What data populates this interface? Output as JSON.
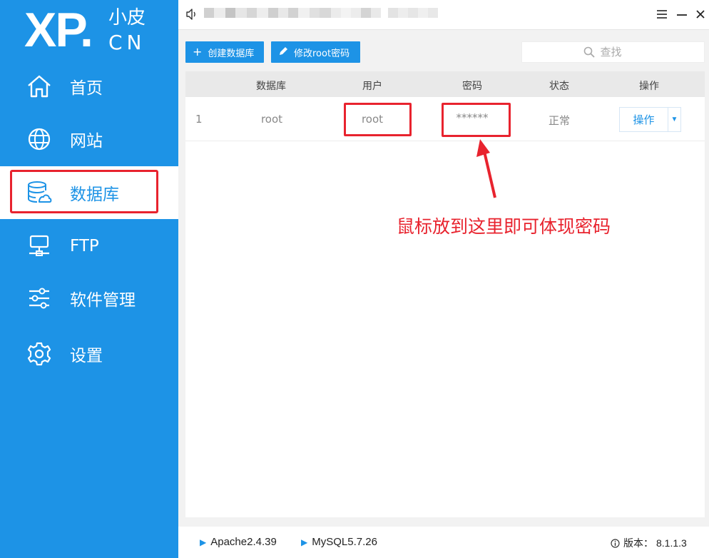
{
  "logo": {
    "main": "XP",
    "dot": ".",
    "zh": "小皮",
    "suffix": "CN"
  },
  "sidebar": {
    "items": [
      {
        "label": "首页",
        "icon": "home-icon"
      },
      {
        "label": "网站",
        "icon": "globe-icon"
      },
      {
        "label": "数据库",
        "icon": "database-icon",
        "active": true
      },
      {
        "label": "FTP",
        "icon": "ftp-icon"
      },
      {
        "label": "软件管理",
        "icon": "sliders-icon"
      },
      {
        "label": "设置",
        "icon": "gear-icon"
      }
    ]
  },
  "titlebar": {
    "menu_icon": "menu-icon",
    "minimize_icon": "minimize-icon",
    "close_icon": "close-icon"
  },
  "toolbar": {
    "create_label": "创建数据库",
    "create_icon": "plus-icon",
    "change_pwd_label": "修改root密码",
    "change_pwd_icon": "pencil-icon",
    "search_placeholder": "查找"
  },
  "table": {
    "headers": [
      "数据库",
      "用户",
      "密码",
      "状态",
      "操作"
    ],
    "rows": [
      {
        "index": "1",
        "database": "root",
        "user": "root",
        "password": "******",
        "status": "正常",
        "action": "操作"
      }
    ]
  },
  "annotation": {
    "text": "鼠标放到这里即可体现密码"
  },
  "footer": {
    "apache": "Apache2.4.39",
    "mysql": "MySQL5.7.26",
    "version_label": "版本：",
    "version_value": "8.1.1.3"
  },
  "colors": {
    "primary": "#1d93e6",
    "highlight": "#e8232e",
    "sidebar_active_bg": "#ffffff"
  }
}
